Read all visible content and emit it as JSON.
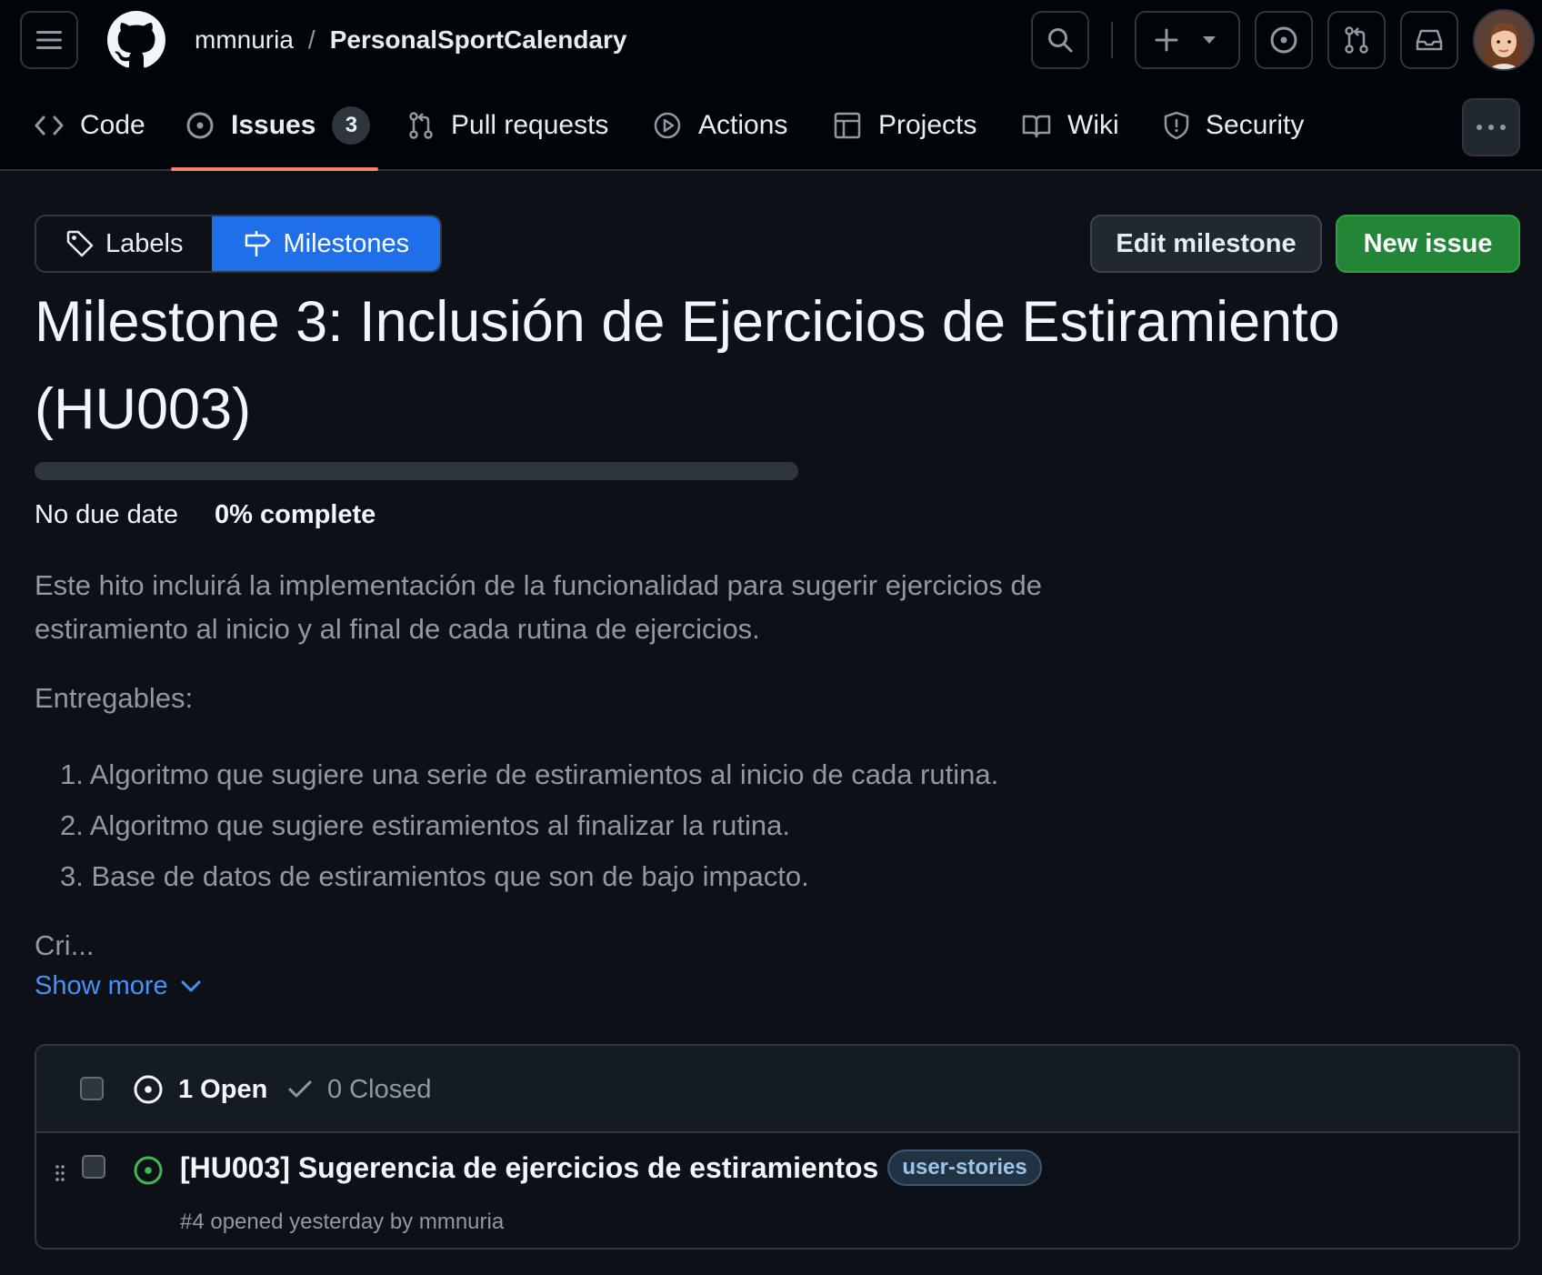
{
  "header": {
    "owner": "mmnuria",
    "separator": "/",
    "repo": "PersonalSportCalendary",
    "icons": [
      "menu-icon",
      "github-logo",
      "search-icon",
      "plus-icon",
      "triangle-down-icon",
      "issue-opened-icon",
      "git-pull-request-icon",
      "inbox-icon",
      "avatar"
    ]
  },
  "repo_nav": {
    "tabs": [
      {
        "label": "Code",
        "icon": "code-icon"
      },
      {
        "label": "Issues",
        "icon": "issue-opened-icon",
        "count": "3",
        "selected": true
      },
      {
        "label": "Pull requests",
        "icon": "git-pull-request-icon"
      },
      {
        "label": "Actions",
        "icon": "play-icon"
      },
      {
        "label": "Projects",
        "icon": "table-icon"
      },
      {
        "label": "Wiki",
        "icon": "book-icon"
      },
      {
        "label": "Security",
        "icon": "shield-icon"
      }
    ],
    "more_icon": "kebab-horizontal-icon"
  },
  "subnav": {
    "labels": "Labels",
    "milestones": "Milestones"
  },
  "actions": {
    "edit_milestone": "Edit milestone",
    "new_issue": "New issue"
  },
  "milestone": {
    "title": "Milestone 3: Inclusión de Ejercicios de Estiramiento (HU003)",
    "progress_percent": 0,
    "due": "No due date",
    "complete_text": "0% complete",
    "description": "Este hito incluirá la implementación de la funcionalidad para sugerir ejercicios de estiramiento al inicio y al final de cada rutina de ejercicios.",
    "deliverables_label": "Entregables:",
    "deliverables": [
      "1. Algoritmo que sugiere una serie de estiramientos al inicio de cada rutina.",
      "2. Algoritmo que sugiere estiramientos al finalizar la rutina.",
      "3. Base de datos de estiramientos que son de bajo impacto."
    ],
    "truncated": "Cri...",
    "show_more": "Show more"
  },
  "issues": {
    "open_label": "1 Open",
    "closed_label": "0 Closed",
    "items": [
      {
        "title": "[HU003] Sugerencia de ejercicios de estiramientos",
        "label": "user-stories",
        "meta": "#4 opened yesterday by mmnuria"
      }
    ]
  },
  "colors": {
    "background": "#0d1117",
    "header": "#010409",
    "accent_blue": "#1f6feb",
    "link_blue": "#4493f8",
    "green": "#238636",
    "open_icon": "#3fb950",
    "tab_underline": "#f78166"
  }
}
